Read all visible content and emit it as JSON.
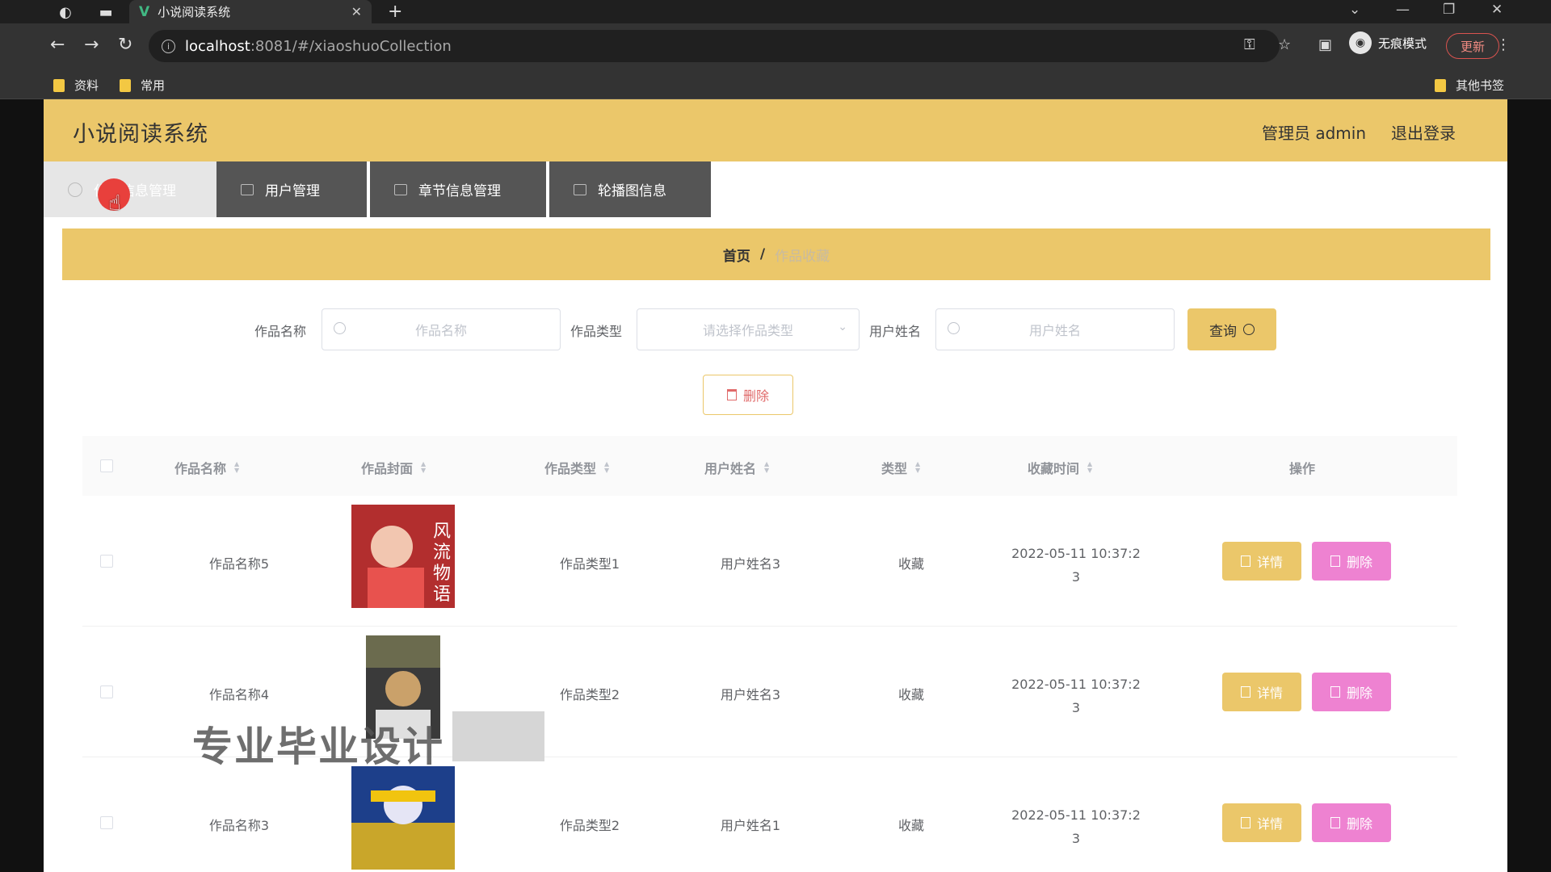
{
  "browser": {
    "tab_title": "小说阅读系统",
    "tab_logo": "V",
    "url_host": "localhost",
    "url_rest": ":8081/#/xiaoshuoCollection",
    "incognito_label": "无痕模式",
    "update_label": "更新",
    "bookmarks": [
      "资料",
      "常用"
    ],
    "other_bookmarks": "其他书签"
  },
  "header": {
    "title": "小说阅读系统",
    "admin": "管理员 admin",
    "logout": "退出登录"
  },
  "menu": [
    {
      "label": "作品信息管理",
      "icon": "compass-icon",
      "active": true
    },
    {
      "label": "用户管理",
      "icon": "card-icon"
    },
    {
      "label": "章节信息管理",
      "icon": "crop-icon"
    },
    {
      "label": "轮播图信息",
      "icon": "send-icon"
    }
  ],
  "breadcrumb": {
    "home": "首页",
    "separator": "/",
    "current": "作品收藏"
  },
  "search": {
    "name_label": "作品名称",
    "name_placeholder": "作品名称",
    "type_label": "作品类型",
    "type_placeholder": "请选择作品类型",
    "user_label": "用户姓名",
    "user_placeholder": "用户姓名",
    "query_label": "查询"
  },
  "bulk_delete_label": "删除",
  "table": {
    "columns": [
      "作品名称",
      "作品封面",
      "作品类型",
      "用户姓名",
      "类型",
      "收藏时间",
      "操作"
    ],
    "rows": [
      {
        "name": "作品名称5",
        "type": "作品类型1",
        "user": "用户姓名3",
        "kind": "收藏",
        "time_1": "2022-05-11 10:37:2",
        "time_2": "3",
        "cover_color": "#c0392b",
        "cover_text": "风流物语"
      },
      {
        "name": "作品名称4",
        "type": "作品类型2",
        "user": "用户姓名3",
        "kind": "收藏",
        "time_1": "2022-05-11 10:37:2",
        "time_2": "3",
        "cover_color": "#2e2e2e",
        "cover_text": ""
      },
      {
        "name": "作品名称3",
        "type": "作品类型2",
        "user": "用户姓名1",
        "kind": "收藏",
        "time_1": "2022-05-11 10:37:2",
        "time_2": "3",
        "cover_color": "#1d3f8a",
        "cover_text": ""
      }
    ],
    "detail_label": "详情",
    "delete_label": "删除"
  },
  "watermark": "专业毕业设计",
  "colors": {
    "accent": "#ebc76a",
    "danger": "#ee82d1",
    "menu_bg": "#555555"
  }
}
